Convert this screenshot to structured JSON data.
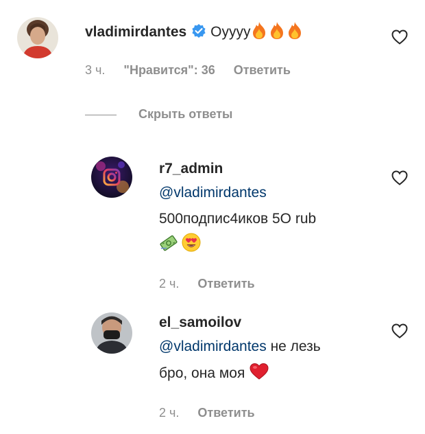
{
  "comment": {
    "username": "vladimirdantes",
    "text": "Оуууу",
    "time": "3 ч.",
    "likes_label": "\"Нравится\": 36",
    "reply_label": "Ответить",
    "verified": true,
    "emoji": "fire-icon x3"
  },
  "hide_replies_label": "Скрыть ответы",
  "replies": [
    {
      "username": "r7_admin",
      "mention": "@vladimirdantes",
      "text_line1": "500подпис4иков 5O rub",
      "time": "2 ч.",
      "reply_label": "Ответить",
      "emoji": [
        "money-icon",
        "heart-eyes-face-icon"
      ]
    },
    {
      "username": "el_samoilov",
      "mention": "@vladimirdantes",
      "text_after_mention": "не лезь",
      "text_line2": "бро, она моя",
      "time": "2 ч.",
      "reply_label": "Ответить",
      "emoji": [
        "red-heart-icon"
      ]
    }
  ],
  "colors": {
    "text": "#262626",
    "meta": "#8e8e8e",
    "mention": "#00376b",
    "verified": "#3897f0"
  }
}
